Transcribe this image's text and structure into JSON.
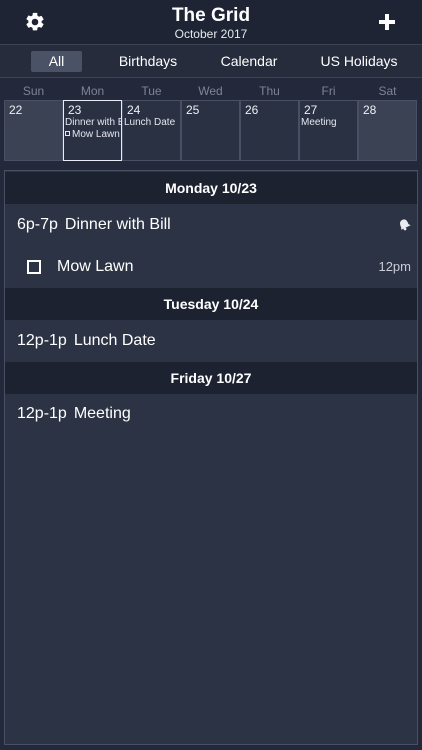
{
  "header": {
    "title": "The Grid",
    "subtitle": "October 2017",
    "settings_icon": "gear-icon",
    "add_icon": "plus-icon"
  },
  "tabs": [
    {
      "label": "All",
      "active": true
    },
    {
      "label": "Birthdays",
      "active": false
    },
    {
      "label": "Calendar",
      "active": false
    },
    {
      "label": "US Holidays",
      "active": false
    }
  ],
  "weekdays": [
    "Sun",
    "Mon",
    "Tue",
    "Wed",
    "Thu",
    "Fri",
    "Sat"
  ],
  "week": [
    {
      "num": "22",
      "events": []
    },
    {
      "num": "23",
      "events": [
        "Dinner with Bill"
      ],
      "tasks": [
        "Mow Lawn"
      ],
      "selected": true
    },
    {
      "num": "24",
      "events": [
        "Lunch Date"
      ]
    },
    {
      "num": "25",
      "events": []
    },
    {
      "num": "26",
      "events": []
    },
    {
      "num": "27",
      "events": [
        "Meeting"
      ]
    },
    {
      "num": "28",
      "events": []
    }
  ],
  "agenda": {
    "monday": {
      "header": "Monday 10/23",
      "event_time": "6p-7p",
      "event_title": "Dinner with Bill",
      "event_icon": "alarm-bell-icon",
      "task_title": "Mow Lawn",
      "task_due": "12pm"
    },
    "tuesday": {
      "header": "Tuesday 10/24",
      "event_time": "12p-1p",
      "event_title": "Lunch Date"
    },
    "friday": {
      "header": "Friday 10/27",
      "event_time": "12p-1p",
      "event_title": "Meeting"
    }
  },
  "colors": {
    "background": "#23293a",
    "header": "#1e2433",
    "day_header": "#1c2230",
    "agenda_bg": "#2c3344",
    "weekend_cell": "#3b4253",
    "active_tab": "#4a5266"
  }
}
